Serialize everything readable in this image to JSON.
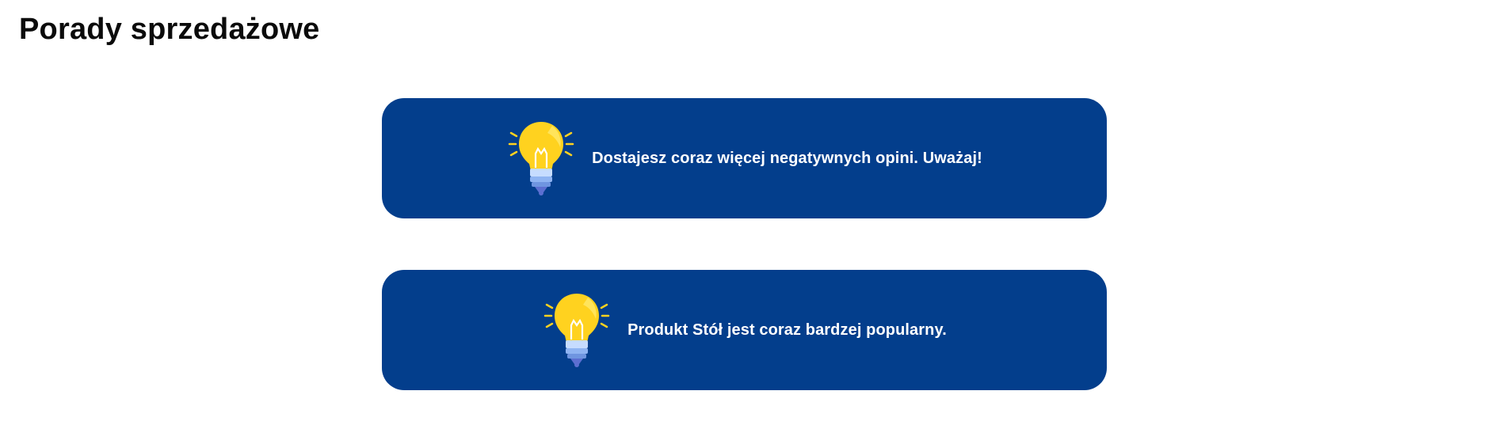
{
  "page": {
    "title": "Porady sprzedażowe"
  },
  "tips": [
    {
      "icon": "lightbulb-icon",
      "text": "Dostajesz coraz więcej negatywnych opini. Uważaj!"
    },
    {
      "icon": "lightbulb-icon",
      "text": "Produkt Stół jest coraz bardzej popularny."
    }
  ],
  "colors": {
    "card_background": "#033e8c",
    "card_text": "#ffffff",
    "title_text": "#0b0b0b",
    "bulb_yellow": "#ffd21f",
    "bulb_base": "#8fb4f2"
  }
}
